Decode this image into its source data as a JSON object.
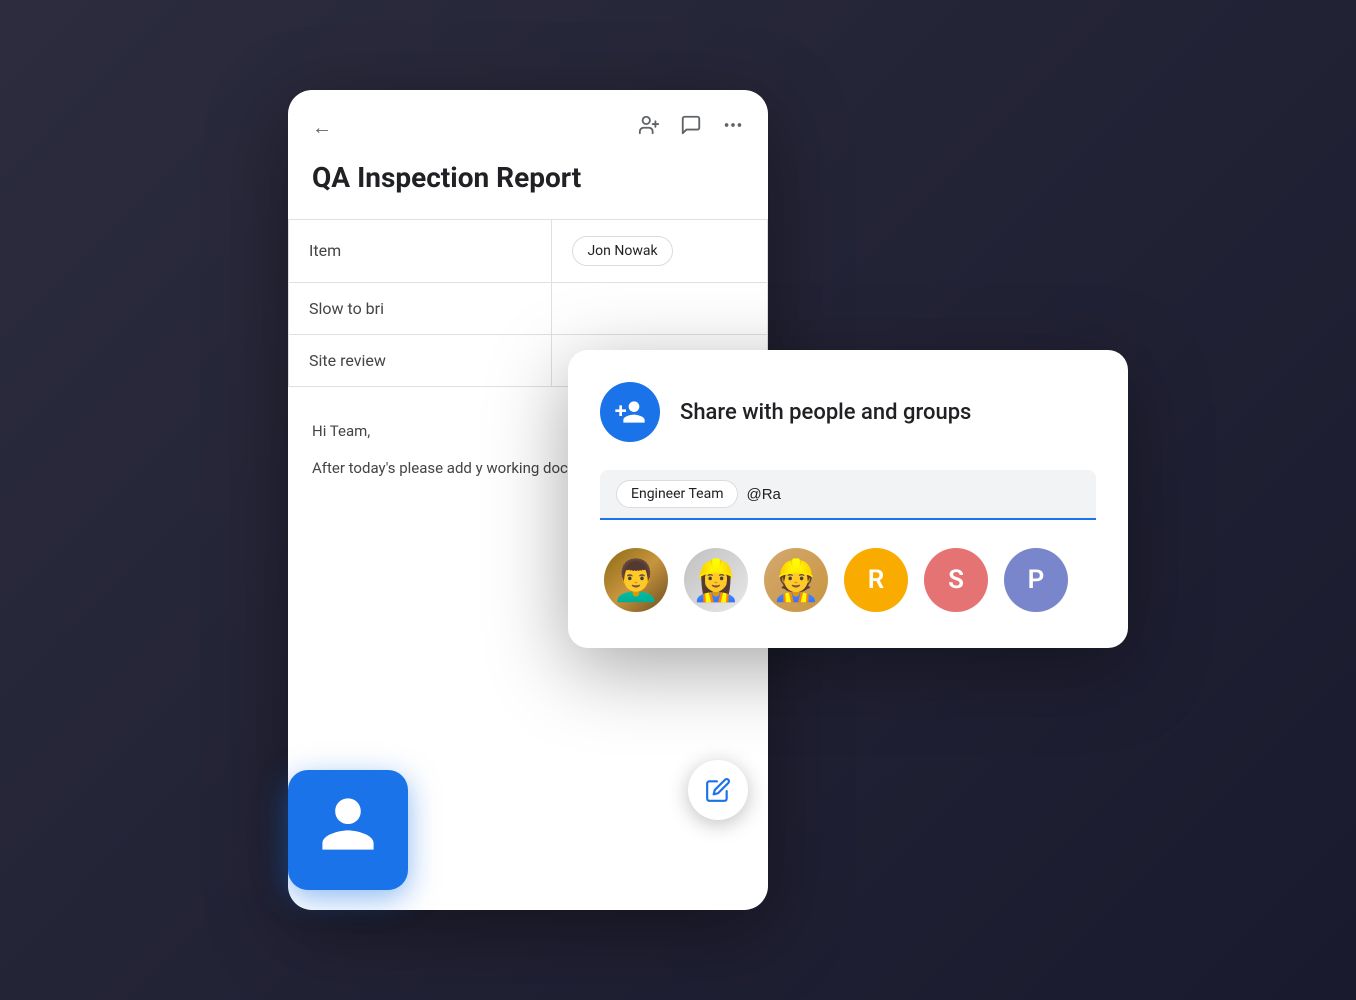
{
  "doc": {
    "title": "QA Inspection Report",
    "back_label": "←",
    "actions": {
      "add_person": "person-add",
      "comment": "comment",
      "more": "more-horiz"
    },
    "table": {
      "rows": [
        {
          "col1": "Item",
          "col2": "Jon Nowak"
        },
        {
          "col1": "Slow to bri",
          "col2": ""
        },
        {
          "col1": "Site review",
          "col2": ""
        }
      ]
    },
    "body": {
      "greeting": "Hi Team,",
      "paragraph": "After today's please add y working doc before next week."
    }
  },
  "share_dialog": {
    "title": "Share with people and groups",
    "chip_label": "Engineer Team",
    "input_value": "@Ra",
    "input_placeholder": "@Ra",
    "avatars": [
      {
        "type": "photo",
        "index": 1,
        "alt": "Person 1"
      },
      {
        "type": "photo",
        "index": 2,
        "alt": "Person 2"
      },
      {
        "type": "photo",
        "index": 3,
        "alt": "Person 3"
      },
      {
        "type": "initial",
        "letter": "R",
        "color_key": "r",
        "alt": "R"
      },
      {
        "type": "initial",
        "letter": "S",
        "color_key": "s",
        "alt": "S"
      },
      {
        "type": "initial",
        "letter": "P",
        "color_key": "p",
        "alt": "P"
      }
    ]
  },
  "fab": {
    "icon": "edit",
    "label": "Edit"
  },
  "person_card": {
    "icon": "person"
  }
}
